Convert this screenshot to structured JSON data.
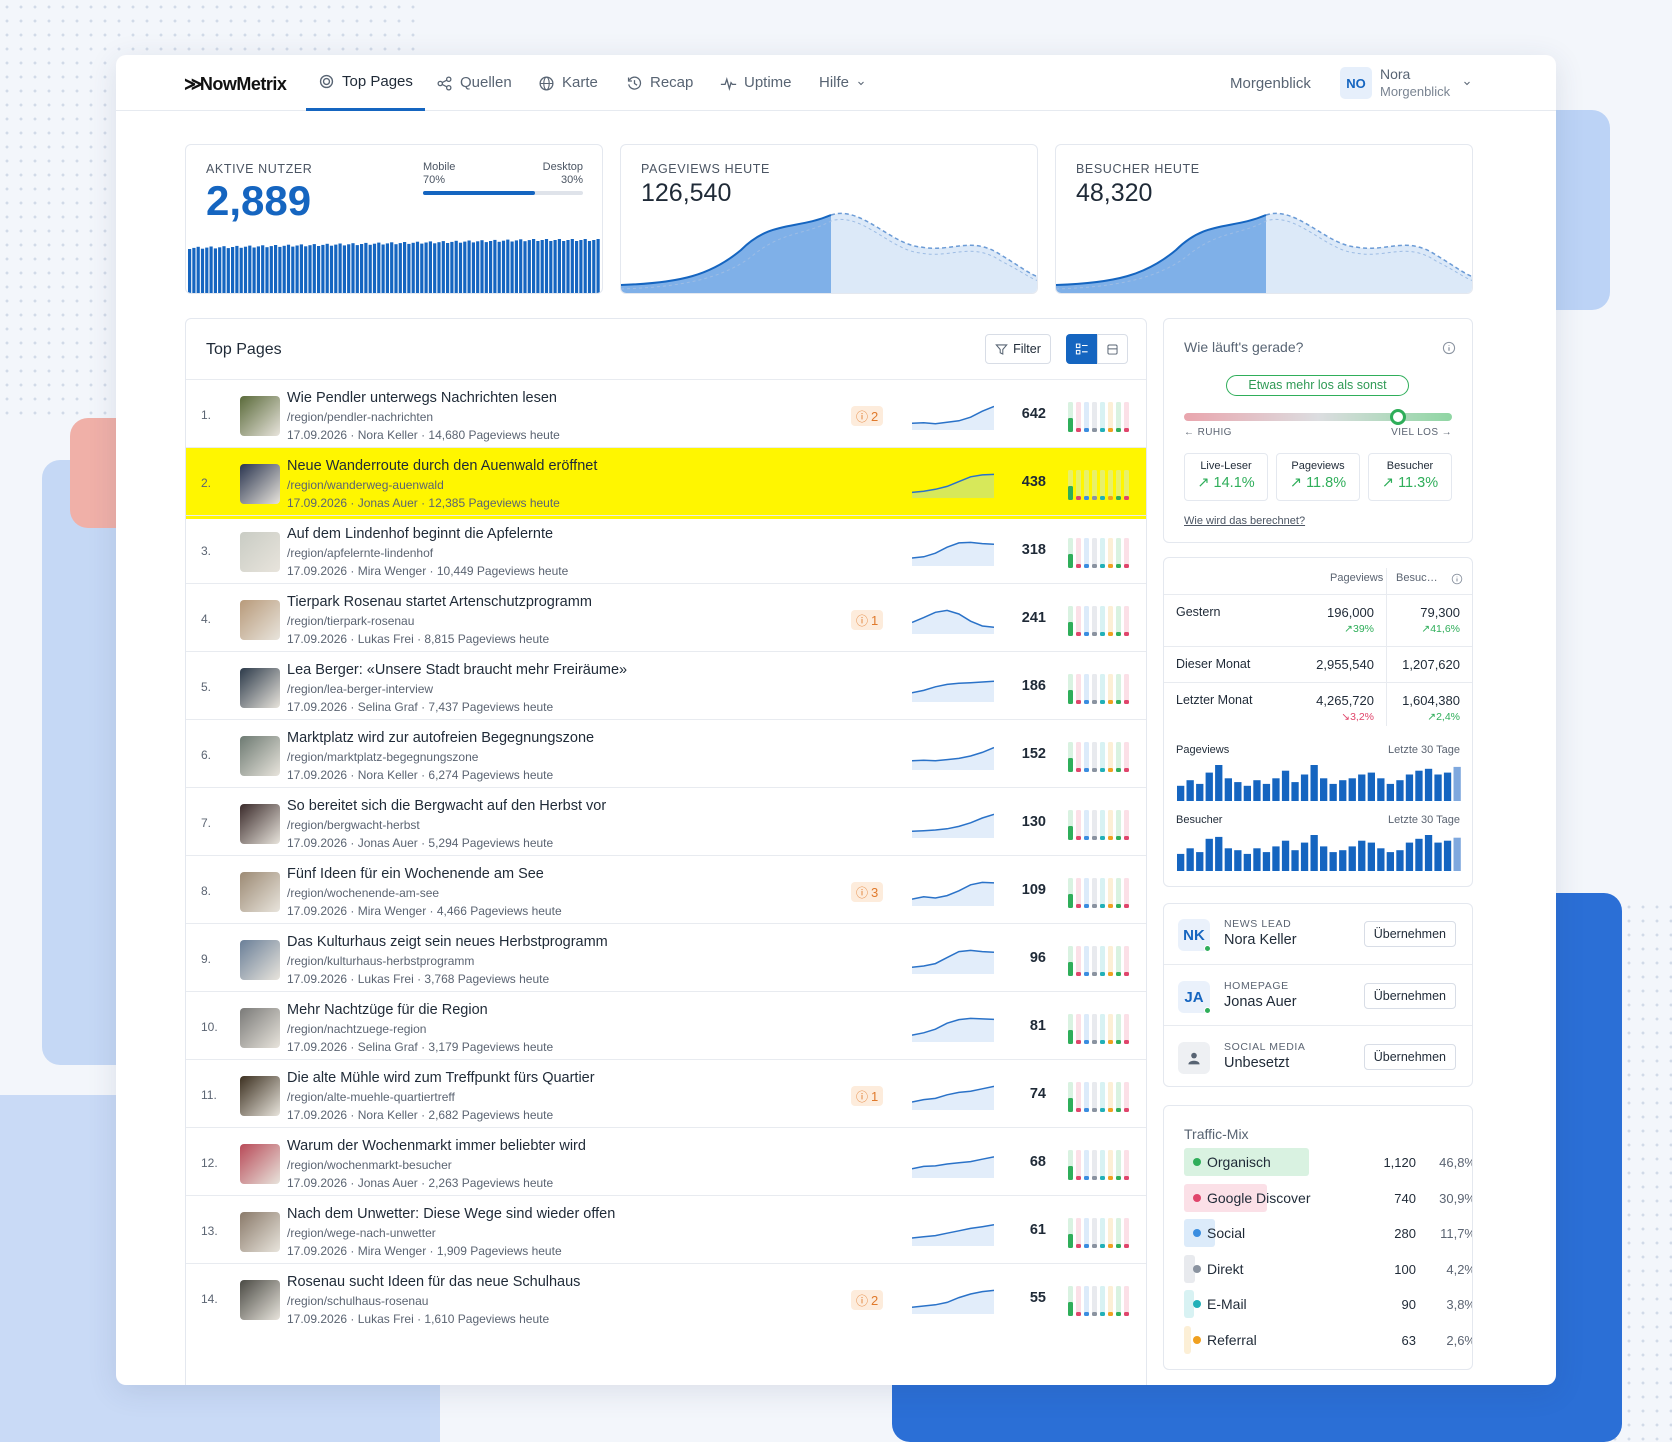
{
  "brand": {
    "logo": "NowMetrix"
  },
  "nav": {
    "tabs": [
      {
        "label": "Top Pages",
        "icon": "target-icon",
        "active": true
      },
      {
        "label": "Quellen",
        "icon": "share-icon"
      },
      {
        "label": "Karte",
        "icon": "globe-icon"
      },
      {
        "label": "Recap",
        "icon": "history-icon"
      },
      {
        "label": "Uptime",
        "icon": "pulse-icon"
      },
      {
        "label": "Hilfe",
        "icon": "chevron-down-icon"
      }
    ],
    "site": "Morgenblick",
    "user": {
      "initials": "NO",
      "name": "Nora",
      "org": "Morgenblick"
    }
  },
  "kpis": {
    "active": {
      "label": "AKTIVE NUTZER",
      "value": "2,889",
      "mobile_label": "Mobile",
      "mobile_pct": "70%",
      "desktop_label": "Desktop",
      "desktop_pct": "30%",
      "mobile_share": 0.7
    },
    "pageviews": {
      "label": "PAGEVIEWS HEUTE",
      "value": "126,540"
    },
    "visitors": {
      "label": "BESUCHER HEUTE",
      "value": "48,320"
    }
  },
  "top_pages": {
    "title": "Top Pages",
    "filter_label": "Filter",
    "rows": [
      {
        "rank": "1.",
        "title": "Wie Pendler unterwegs Nachrichten lesen",
        "path": "/region/pendler-nachrichten",
        "meta": "17.09.2026 · Nora Keller · 14,680 Pageviews heute",
        "badge": "2",
        "value": "642",
        "spark": [
          0.2,
          0.22,
          0.18,
          0.24,
          0.3,
          0.45,
          0.7,
          0.9
        ]
      },
      {
        "rank": "2.",
        "title": "Neue Wanderroute durch den Auenwald eröffnet",
        "path": "/region/wanderweg-auenwald",
        "meta": "17.09.2026 · Jonas Auer · 12,385 Pageviews heute",
        "badge": "",
        "value": "438",
        "spark": [
          0.15,
          0.2,
          0.28,
          0.4,
          0.6,
          0.8,
          0.88,
          0.9
        ],
        "highlight": true
      },
      {
        "rank": "3.",
        "title": "Auf dem Lindenhof beginnt die Apfelernte",
        "path": "/region/apfelernte-lindenhof",
        "meta": "17.09.2026 · Mira Wenger · 10,449 Pageviews heute",
        "badge": "",
        "value": "318",
        "spark": [
          0.25,
          0.3,
          0.45,
          0.7,
          0.88,
          0.9,
          0.85,
          0.82
        ]
      },
      {
        "rank": "4.",
        "title": "Tierpark Rosenau startet Artenschutzprogramm",
        "path": "/region/tierpark-rosenau",
        "meta": "17.09.2026 · Lukas Frei · 8,815 Pageviews heute",
        "badge": "1",
        "value": "241",
        "spark": [
          0.4,
          0.6,
          0.82,
          0.9,
          0.75,
          0.45,
          0.25,
          0.2
        ]
      },
      {
        "rank": "5.",
        "title": "Lea Berger: «Unsere Stadt braucht mehr Freiräume»",
        "path": "/region/lea-berger-interview",
        "meta": "17.09.2026 · Selina Graf · 7,437 Pageviews heute",
        "badge": "",
        "value": "186",
        "spark": [
          0.3,
          0.4,
          0.55,
          0.65,
          0.7,
          0.72,
          0.75,
          0.78
        ]
      },
      {
        "rank": "6.",
        "title": "Marktplatz wird zur autofreien Begegnungszone",
        "path": "/region/marktplatz-begegnungszone",
        "meta": "17.09.2026 · Nora Keller · 6,274 Pageviews heute",
        "badge": "",
        "value": "152",
        "spark": [
          0.3,
          0.32,
          0.3,
          0.35,
          0.4,
          0.5,
          0.65,
          0.85
        ]
      },
      {
        "rank": "7.",
        "title": "So bereitet sich die Bergwacht auf den Herbst vor",
        "path": "/region/bergwacht-herbst",
        "meta": "17.09.2026 · Jonas Auer · 5,294 Pageviews heute",
        "badge": "",
        "value": "130",
        "spark": [
          0.2,
          0.22,
          0.25,
          0.3,
          0.4,
          0.55,
          0.75,
          0.9
        ]
      },
      {
        "rank": "8.",
        "title": "Fünf Ideen für ein Wochenende am See",
        "path": "/region/wochenende-am-see",
        "meta": "17.09.2026 · Mira Wenger · 4,466 Pageviews heute",
        "badge": "3",
        "value": "109",
        "spark": [
          0.2,
          0.3,
          0.25,
          0.35,
          0.55,
          0.8,
          0.9,
          0.88
        ]
      },
      {
        "rank": "9.",
        "title": "Das Kulturhaus zeigt sein neues Herbstprogramm",
        "path": "/region/kulturhaus-herbstprogramm",
        "meta": "17.09.2026 · Lukas Frei · 3,768 Pageviews heute",
        "badge": "",
        "value": "96",
        "spark": [
          0.2,
          0.25,
          0.35,
          0.6,
          0.85,
          0.9,
          0.85,
          0.82
        ]
      },
      {
        "rank": "10.",
        "title": "Mehr Nachtzüge für die Region",
        "path": "/region/nachtzuege-region",
        "meta": "17.09.2026 · Selina Graf · 3,179 Pageviews heute",
        "badge": "",
        "value": "81",
        "spark": [
          0.2,
          0.3,
          0.45,
          0.7,
          0.85,
          0.9,
          0.88,
          0.86
        ]
      },
      {
        "rank": "11.",
        "title": "Die alte Mühle wird zum Treffpunkt fürs Quartier",
        "path": "/region/alte-muehle-quartiertreff",
        "meta": "17.09.2026 · Nora Keller · 2,682 Pageviews heute",
        "badge": "1",
        "value": "74",
        "spark": [
          0.25,
          0.35,
          0.4,
          0.55,
          0.65,
          0.7,
          0.8,
          0.9
        ]
      },
      {
        "rank": "12.",
        "title": "Warum der Wochenmarkt immer beliebter wird",
        "path": "/region/wochenmarkt-besucher",
        "meta": "17.09.2026 · Jonas Auer · 2,263 Pageviews heute",
        "badge": "",
        "value": "68",
        "spark": [
          0.3,
          0.4,
          0.42,
          0.5,
          0.55,
          0.6,
          0.7,
          0.8
        ]
      },
      {
        "rank": "13.",
        "title": "Nach dem Unwetter: Diese Wege sind wieder offen",
        "path": "/region/wege-nach-unwetter",
        "meta": "17.09.2026 · Mira Wenger · 1,909 Pageviews heute",
        "badge": "",
        "value": "61",
        "spark": [
          0.25,
          0.3,
          0.35,
          0.45,
          0.55,
          0.65,
          0.72,
          0.8
        ]
      },
      {
        "rank": "14.",
        "title": "Rosenau sucht Ideen für das neue Schulhaus",
        "path": "/region/schulhaus-rosenau",
        "meta": "17.09.2026 · Lukas Frei · 1,610 Pageviews heute",
        "badge": "2",
        "value": "55",
        "spark": [
          0.2,
          0.25,
          0.3,
          0.4,
          0.6,
          0.75,
          0.85,
          0.9
        ]
      }
    ]
  },
  "status": {
    "title": "Wie läuft's gerade?",
    "pill": "Etwas mehr los als sonst",
    "left": "← RUHIG",
    "right": "VIEL LOS →",
    "level": 0.8,
    "stats": [
      {
        "label": "Live-Leser",
        "value": "14.1%"
      },
      {
        "label": "Pageviews",
        "value": "11.8%"
      },
      {
        "label": "Besucher",
        "value": "11.3%"
      }
    ],
    "link": "Wie wird das berechnet?"
  },
  "summary": {
    "col1": "Pageviews",
    "col2": "Besuc…",
    "rows": [
      {
        "label": "Gestern",
        "pv": "196,000",
        "pv_chg": "39%",
        "pv_dir": "up",
        "vis": "79,300",
        "vis_chg": "41,6%",
        "vis_dir": "up"
      },
      {
        "label": "Dieser Monat",
        "pv": "2,955,540",
        "pv_chg": "",
        "pv_dir": "",
        "vis": "1,207,620",
        "vis_chg": "",
        "vis_dir": ""
      },
      {
        "label": "Letzter Monat",
        "pv": "4,265,720",
        "pv_chg": "3,2%",
        "pv_dir": "down",
        "vis": "1,604,380",
        "vis_chg": "2,4%",
        "vis_dir": "up"
      }
    ],
    "charts": [
      {
        "label": "Pageviews",
        "period": "Letzte 30 Tage"
      },
      {
        "label": "Besucher",
        "period": "Letzte 30 Tage"
      }
    ]
  },
  "people": [
    {
      "initials": "NK",
      "role": "NEWS LEAD",
      "name": "Nora Keller",
      "button": "Übernehmen",
      "online": true
    },
    {
      "initials": "JA",
      "role": "HOMEPAGE",
      "name": "Jonas Auer",
      "button": "Übernehmen",
      "online": true
    },
    {
      "initials": "",
      "role": "SOCIAL MEDIA",
      "name": "Unbesetzt",
      "button": "Übernehmen",
      "online": false
    }
  ],
  "traffic": {
    "title": "Traffic-Mix",
    "items": [
      {
        "label": "Organisch",
        "value": "1,120",
        "pct": "46,8%",
        "share": 0.468,
        "color": "#2fae5a",
        "bg": "#d9f2e1"
      },
      {
        "label": "Google Discover",
        "value": "740",
        "pct": "30,9%",
        "share": 0.309,
        "color": "#e0456b",
        "bg": "#fbe0e7"
      },
      {
        "label": "Social",
        "value": "280",
        "pct": "11,7%",
        "share": 0.117,
        "color": "#3a8de0",
        "bg": "#dcebfa"
      },
      {
        "label": "Direkt",
        "value": "100",
        "pct": "4,2%",
        "share": 0.042,
        "color": "#8a93a0",
        "bg": "#e8eaee"
      },
      {
        "label": "E-Mail",
        "value": "90",
        "pct": "3,8%",
        "share": 0.038,
        "color": "#21b0b8",
        "bg": "#d8f2f3"
      },
      {
        "label": "Referral",
        "value": "63",
        "pct": "2,6%",
        "share": 0.026,
        "color": "#f0a020",
        "bg": "#fcefd6"
      }
    ]
  },
  "chart_data": [
    {
      "type": "bar",
      "title": "Pageviews",
      "period": "Letzte 30 Tage",
      "values": [
        40,
        55,
        45,
        75,
        95,
        60,
        50,
        40,
        55,
        45,
        60,
        80,
        50,
        70,
        95,
        60,
        45,
        55,
        60,
        70,
        75,
        60,
        45,
        55,
        70,
        80,
        85,
        70,
        75,
        90
      ]
    },
    {
      "type": "bar",
      "title": "Besucher",
      "period": "Letzte 30 Tage",
      "values": [
        45,
        60,
        50,
        85,
        90,
        60,
        55,
        45,
        60,
        50,
        65,
        80,
        55,
        75,
        95,
        65,
        50,
        55,
        65,
        80,
        75,
        60,
        50,
        55,
        75,
        85,
        95,
        75,
        80,
        88
      ]
    }
  ]
}
